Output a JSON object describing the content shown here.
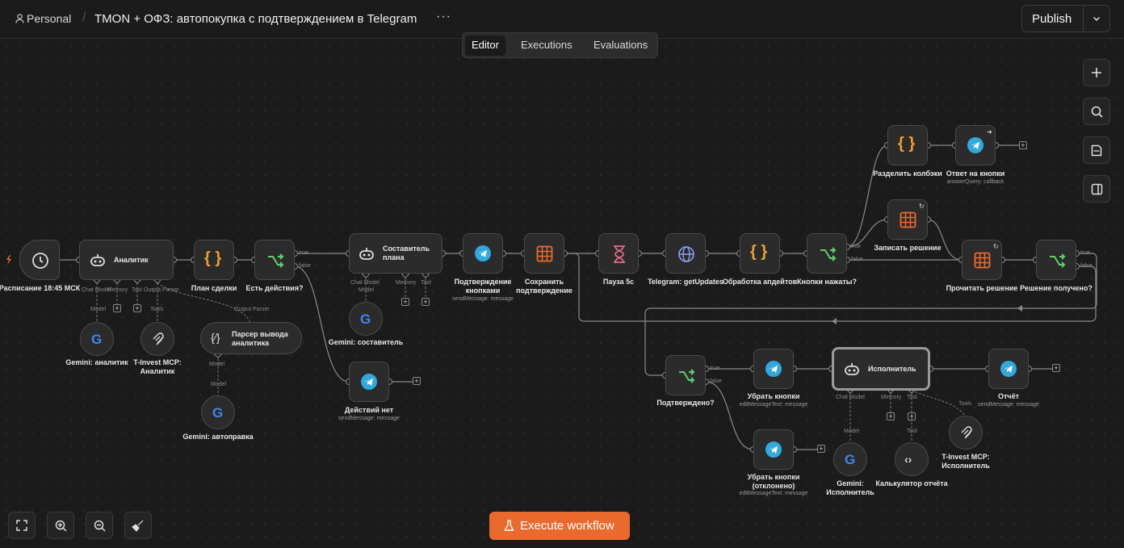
{
  "header": {
    "workspace": "Personal",
    "workflow_title": "TMON + ОФЗ: автопокупка с подтверждением в Telegram",
    "more_label": "···",
    "publish_label": "Publish"
  },
  "tabs": [
    {
      "label": "Editor",
      "active": true
    },
    {
      "label": "Executions",
      "active": false
    },
    {
      "label": "Evaluations",
      "active": false
    }
  ],
  "execute_label": "Execute workflow",
  "colors": {
    "accent": "#e96a2c",
    "telegram": "#33a8dd",
    "if_green": "#5fcf6a",
    "code_orange": "#f0a030",
    "sheet_orange": "#ee6a2c"
  },
  "nodes": {
    "schedule": {
      "label": "Расписание 18:45 МСК"
    },
    "analyst": {
      "label": "Аналитик",
      "ports": [
        "Chat Model",
        "Memory",
        "Tool",
        "Output Parser"
      ]
    },
    "plan": {
      "label": "План сделки"
    },
    "has_actions": {
      "label": "Есть действия?",
      "true": "true",
      "false": "false"
    },
    "gemini_analyst": {
      "label": "Gemini: аналитик",
      "port": "Model"
    },
    "tinvest_analyst": {
      "label": "T-Invest MCP:\nАналитик",
      "port": "Tools"
    },
    "parser": {
      "label": "Парсер вывода\nаналитика",
      "port": "Output Parser",
      "model_port": "Model",
      "model_port2": "Model"
    },
    "gemini_autofix": {
      "label": "Gemini: автоправка"
    },
    "composer": {
      "label": "Составитель\nплана",
      "ports": [
        "Chat Model",
        "Memory",
        "Tool"
      ],
      "model_port": "Model"
    },
    "gemini_composer": {
      "label": "Gemini: составитель"
    },
    "no_actions": {
      "label": "Действий нет",
      "sub": "sendMessage: message"
    },
    "confirm_buttons": {
      "label": "Подтверждение\nкнопками",
      "sub": "sendMessage: message"
    },
    "save_confirm": {
      "label": "Сохранить\nподтверждение"
    },
    "pause": {
      "label": "Пауза 5с"
    },
    "get_updates": {
      "label": "Telegram: getUpdates"
    },
    "process_updates": {
      "label": "Обработка апдейтов"
    },
    "buttons_pressed": {
      "label": "Кнопки нажаты?",
      "true": "true",
      "false": "false"
    },
    "split_callbacks": {
      "label": "Разделить колбэки"
    },
    "answer_buttons": {
      "label": "Ответ на кнопки",
      "sub": "answerQuery: callback"
    },
    "write_decision": {
      "label": "Записать решение"
    },
    "read_decision": {
      "label": "Прочитать решение"
    },
    "decision_received": {
      "label": "Решение получено?",
      "true": "true",
      "false": "false"
    },
    "confirmed": {
      "label": "Подтверждено?",
      "true": "true",
      "false": "false"
    },
    "remove_buttons": {
      "label": "Убрать кнопки",
      "sub": "editMessageText: message"
    },
    "remove_buttons_rejected": {
      "label": "Убрать кнопки\n(отклонено)",
      "sub": "editMessageText: message"
    },
    "executor": {
      "label": "Исполнитель",
      "ports": [
        "Chat Model",
        "Memory",
        "Tool"
      ],
      "model_port": "Model",
      "tool_port": "Tool",
      "tools_port": "Tools"
    },
    "report": {
      "label": "Отчёт",
      "sub": "sendMessage: message"
    },
    "gemini_executor": {
      "label": "Gemini:\nИсполнитель"
    },
    "calculator": {
      "label": "Калькулятор отчёта"
    },
    "tinvest_executor": {
      "label": "T-Invest MCP:\nИсполнитель"
    }
  }
}
